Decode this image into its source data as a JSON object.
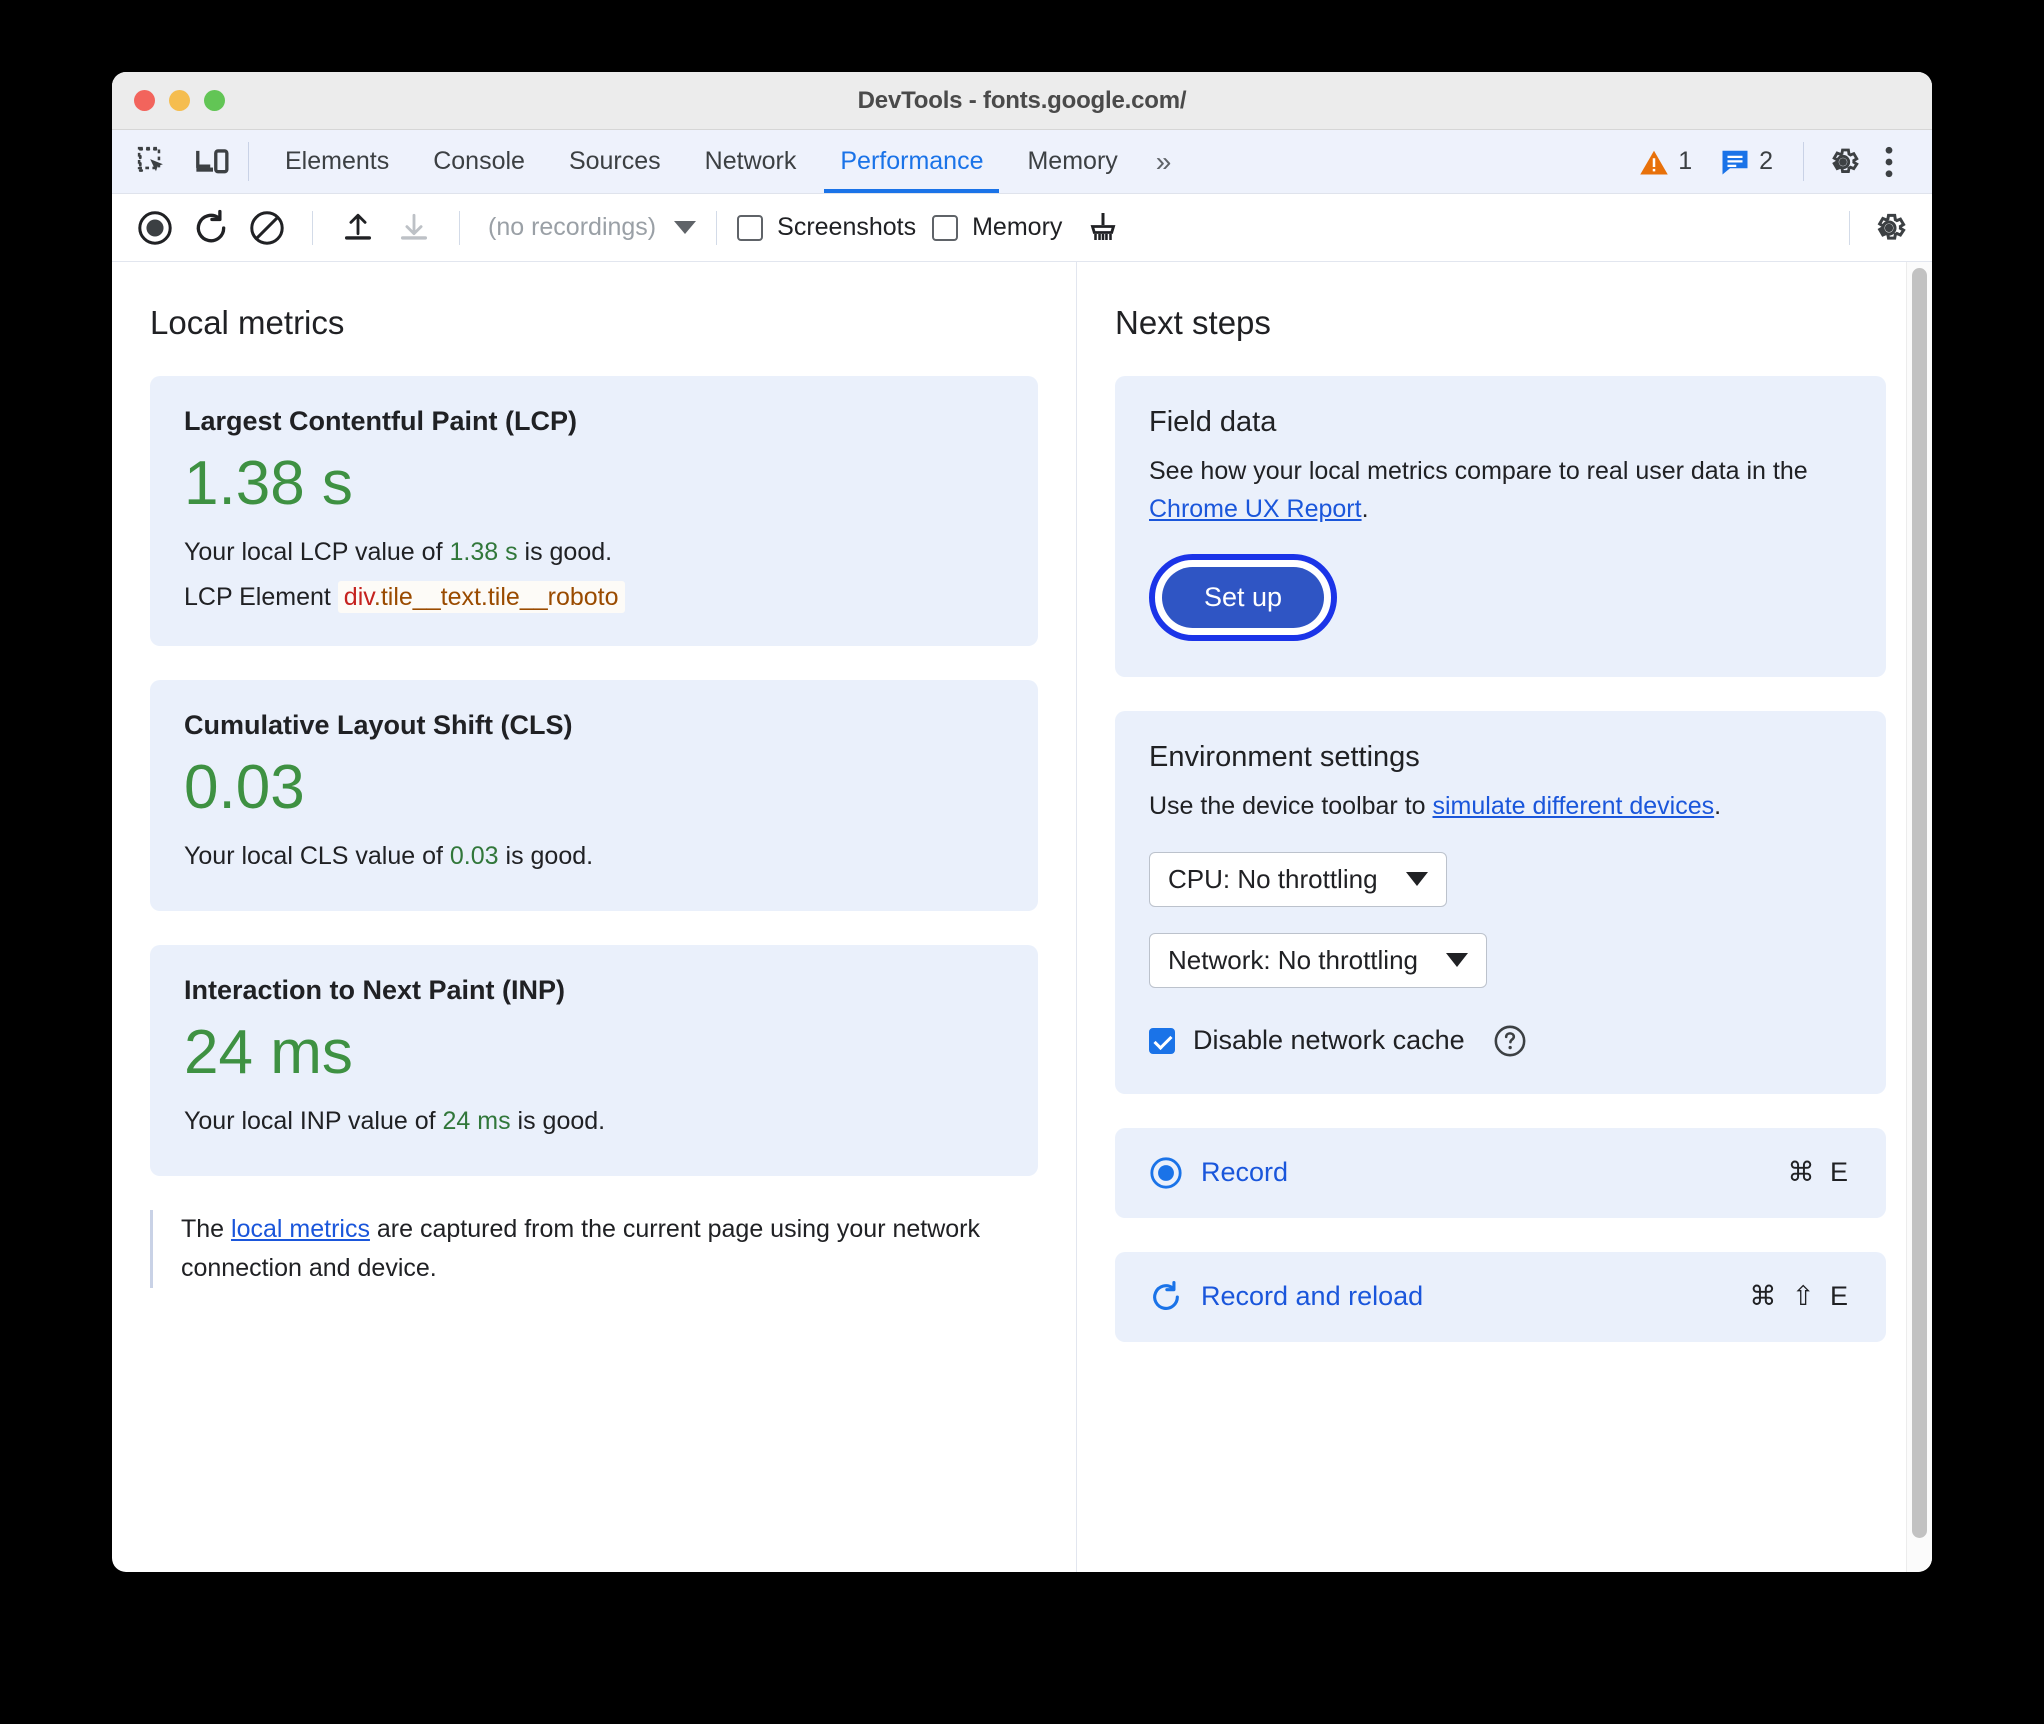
{
  "window": {
    "title": "DevTools - fonts.google.com/"
  },
  "tabbar": {
    "icons": [
      {
        "name": "inspect-element-icon"
      },
      {
        "name": "device-toolbar-icon"
      }
    ],
    "tabs": [
      {
        "label": "Elements",
        "active": false
      },
      {
        "label": "Console",
        "active": false
      },
      {
        "label": "Sources",
        "active": false
      },
      {
        "label": "Network",
        "active": false
      },
      {
        "label": "Performance",
        "active": true
      },
      {
        "label": "Memory",
        "active": false
      }
    ],
    "more_label": "»",
    "warning_count": "1",
    "issue_count": "2",
    "settings_icon": "gear-icon",
    "more_options_icon": "kebab-menu-icon"
  },
  "perftoolbar": {
    "record_icon": "record-circle-icon",
    "reload_icon": "record-and-reload-icon",
    "clear_icon": "clear-icon",
    "upload_icon": "load-profile-icon",
    "download_icon": "save-profile-icon",
    "recordings_label": "(no recordings)",
    "screenshots_label": "Screenshots",
    "screenshots_checked": false,
    "memory_label": "Memory",
    "memory_checked": false,
    "collect_garbage_icon": "brush-icon",
    "capture_settings_icon": "gear-icon"
  },
  "local_metrics": {
    "heading": "Local metrics",
    "cards": [
      {
        "title": "Largest Contentful Paint (LCP)",
        "value": "1.38 s",
        "note_prefix": "Your local LCP value of ",
        "note_value": "1.38 s",
        "note_suffix": " is good.",
        "element_label": "LCP Element",
        "element_tag": "div",
        "element_classes": ".tile__text.tile__roboto"
      },
      {
        "title": "Cumulative Layout Shift (CLS)",
        "value": "0.03",
        "note_prefix": "Your local CLS value of ",
        "note_value": "0.03",
        "note_suffix": " is good."
      },
      {
        "title": "Interaction to Next Paint (INP)",
        "value": "24 ms",
        "note_prefix": "Your local INP value of ",
        "note_value": "24 ms",
        "note_suffix": " is good."
      }
    ],
    "footnote_prefix": "The ",
    "footnote_link": "local metrics",
    "footnote_suffix": " are captured from the current page using your network connection and device."
  },
  "next_steps": {
    "heading": "Next steps",
    "field_data": {
      "title": "Field data",
      "text_prefix": "See how your local metrics compare to real user data in the ",
      "link": "Chrome UX Report",
      "text_suffix": ".",
      "setup_button": "Set up"
    },
    "environment": {
      "title": "Environment settings",
      "text_prefix": "Use the device toolbar to ",
      "link": "simulate different devices",
      "text_suffix": ".",
      "cpu_select": "CPU: No throttling",
      "network_select": "Network: No throttling",
      "cache_label": "Disable network cache",
      "cache_checked": true,
      "help_icon": "question-mark-icon"
    },
    "actions": [
      {
        "icon": "record-circle-icon",
        "label": "Record",
        "keys": "⌘ E"
      },
      {
        "icon": "record-and-reload-icon",
        "label": "Record and reload",
        "keys": "⌘ ⇧ E"
      }
    ]
  },
  "colors": {
    "accent_blue": "#1a73e8",
    "link_blue": "#1a56db",
    "good_green": "#3e9142",
    "card_bg": "#eaf0fb",
    "focus_ring": "#1b34e8",
    "warning_orange": "#e8710a"
  }
}
